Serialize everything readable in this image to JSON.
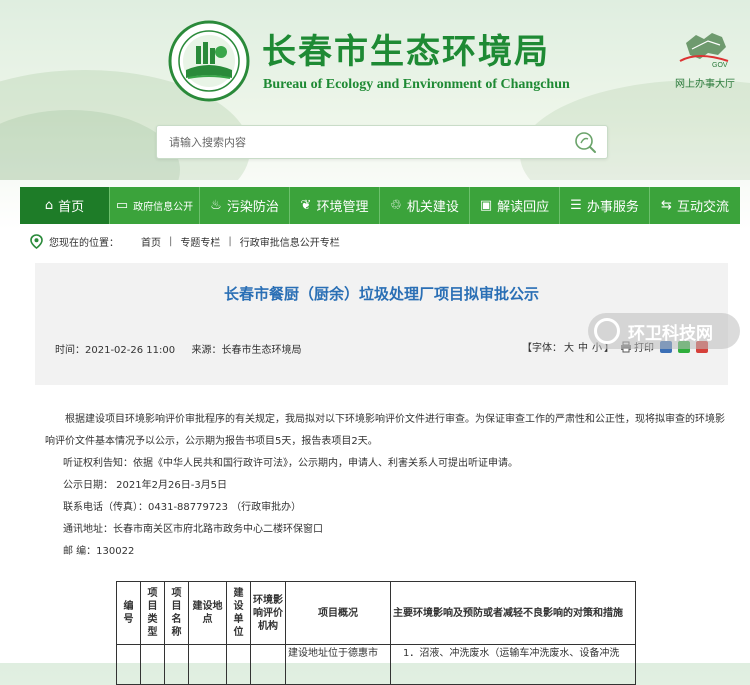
{
  "header": {
    "title_cn": "长春市生态环境局",
    "title_en": "Bureau of Ecology and Environment of Changchun",
    "gov_service_label": "网上办事大厅",
    "gov_logo_text": "GOV"
  },
  "search": {
    "placeholder": "请输入搜索内容"
  },
  "nav": {
    "items": [
      {
        "label": "首页",
        "icon": "home-icon"
      },
      {
        "label": "政府信息公开",
        "icon": "document-icon"
      },
      {
        "label": "污染防治",
        "icon": "drop-icon"
      },
      {
        "label": "环境管理",
        "icon": "leaf-icon"
      },
      {
        "label": "机关建设",
        "icon": "building-icon"
      },
      {
        "label": "解读回应",
        "icon": "chat-icon"
      },
      {
        "label": "办事服务",
        "icon": "list-icon"
      },
      {
        "label": "互动交流",
        "icon": "exchange-icon"
      }
    ]
  },
  "breadcrumb": {
    "prefix": "您现在的位置：",
    "items": [
      "首页",
      "专题专栏",
      "行政审批信息公开专栏"
    ],
    "separator": "|"
  },
  "article": {
    "title": "长春市餐厨（厨余）垃圾处理厂项目拟审批公示",
    "time_label": "时间：",
    "time": "2021-02-26 11:00",
    "source_label": "来源：",
    "source": "长春市生态环境局",
    "font_label": "【字体：",
    "font_large": "大",
    "font_medium": "中",
    "font_small": "小",
    "font_close": "】",
    "print_label": "打印"
  },
  "watermark": {
    "text": "环卫科技网"
  },
  "body": {
    "paragraph1": "根据建设项目环境影响评价审批程序的有关规定，我局拟对以下环境影响评价文件进行审查。为保证审查工作的严肃性和公正性，现将拟审查的环境影响评价文件基本情况予以公示，公示期为报告书项目5天，报告表项目2天。",
    "hearing": "听证权利告知：依据《中华人民共和国行政许可法》，公示期内，申请人、利害关系人可提出听证申请。",
    "date_line": "公示日期：  2021年2月26日-3月5日",
    "phone_line": "联系电话（传真）：0431-88779723  （行政审批办）",
    "address_line": "通讯地址：长春市南关区市府北路市政务中心二楼环保窗口",
    "postcode_line": "邮    编：130022"
  },
  "table": {
    "headers": [
      "编号",
      "项目类型",
      "项目名称",
      "建设地点",
      "建设单位",
      "环境影响评价机构",
      "项目概况",
      "主要环境影响及预防或者减轻不良影响的对策和措施"
    ],
    "row1": {
      "overview": "建设地址位于德惠市",
      "measures": "1．沼液、冲洗废水（运输车冲洗废水、设备冲洗"
    }
  },
  "colors": {
    "brand_green": "#1e8a34",
    "nav_green": "#3ba33b",
    "nav_active": "#1e7c28",
    "title_blue": "#2a6fb5"
  }
}
